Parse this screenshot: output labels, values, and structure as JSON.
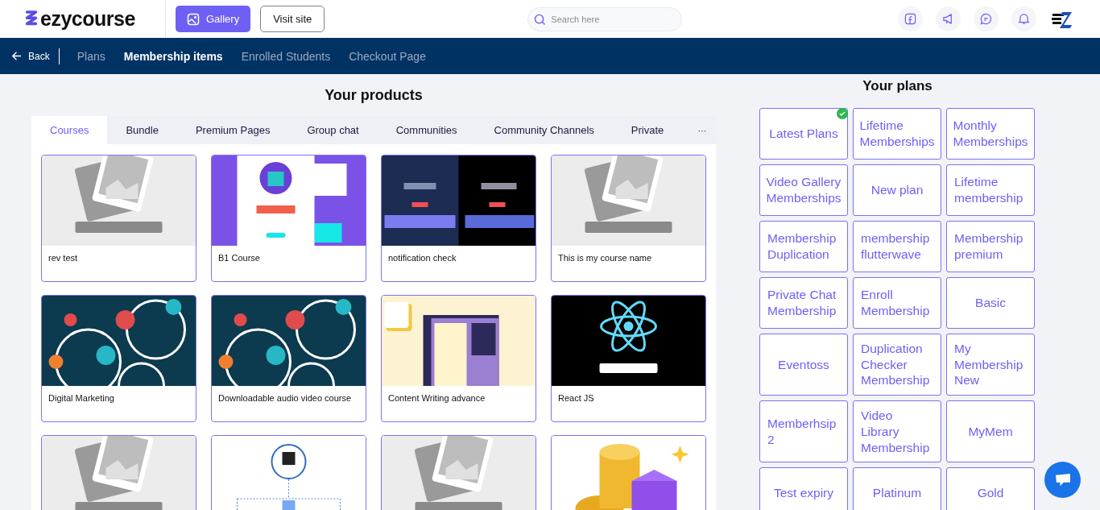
{
  "header": {
    "logo": "ezycourse",
    "gallery_button": "Gallery",
    "visit_button": "Visit site",
    "search": {
      "placeholder": "Search here"
    }
  },
  "nav": {
    "back": "Back",
    "items": [
      {
        "label": "Plans",
        "selected": false
      },
      {
        "label": "Membership items",
        "selected": true
      },
      {
        "label": "Enrolled Students",
        "selected": false
      },
      {
        "label": "Checkout Page",
        "selected": false
      }
    ]
  },
  "products": {
    "title": "Your products",
    "tabs": [
      {
        "label": "Courses",
        "selected": true
      },
      {
        "label": "Bundle",
        "selected": false
      },
      {
        "label": "Premium Pages",
        "selected": false
      },
      {
        "label": "Group chat",
        "selected": false
      },
      {
        "label": "Communities",
        "selected": false
      },
      {
        "label": "Community Channels",
        "selected": false
      },
      {
        "label": "Private",
        "selected": false
      }
    ],
    "more": "···",
    "courses": [
      {
        "kind": "picture",
        "title": "rev test"
      },
      {
        "kind": "picture",
        "title": "B1 Course"
      },
      {
        "kind": "picture",
        "title": "notification check"
      },
      {
        "kind": "picture",
        "title": "This is my course name"
      },
      {
        "kind": "picture",
        "title": "Digital Marketing"
      },
      {
        "kind": "picture",
        "title": "Downloadable audio video course"
      },
      {
        "kind": "picture",
        "title": "Content Writing advance"
      },
      {
        "kind": "picture",
        "title": "React JS"
      },
      {
        "kind": "picture"
      },
      {
        "kind": "picture"
      },
      {
        "kind": "picture"
      },
      {
        "kind": "picture"
      }
    ]
  },
  "plans": {
    "title": "Your plans",
    "items": [
      {
        "label": "Latest Plans",
        "selected": true
      },
      {
        "label": "Lifetime Memberships",
        "selected": false
      },
      {
        "label": "Monthly Memberships",
        "selected": false
      },
      {
        "label": "Video Gallery Memberships",
        "selected": false
      },
      {
        "label": "New plan",
        "selected": false
      },
      {
        "label": "Lifetime membership",
        "selected": false
      },
      {
        "label": "Membership Duplication",
        "selected": false
      },
      {
        "label": "membership flutterwave",
        "selected": false
      },
      {
        "label": "Membership premium",
        "selected": false
      },
      {
        "label": "Private Chat Membership",
        "selected": false
      },
      {
        "label": "Enroll Membership",
        "selected": false
      },
      {
        "label": "Basic",
        "selected": false
      },
      {
        "label": "Eventoss",
        "selected": false
      },
      {
        "label": "Duplication Checker Membership",
        "selected": false
      },
      {
        "label": "My Membership New",
        "selected": false
      },
      {
        "label": "Memberhsip 2",
        "selected": false
      },
      {
        "label": "Video Library Membership",
        "selected": false
      },
      {
        "label": "MyMem",
        "selected": false
      },
      {
        "label": "Test expiry",
        "selected": false
      },
      {
        "label": "Platinum",
        "selected": false
      },
      {
        "label": "Gold",
        "selected": false
      }
    ]
  }
}
